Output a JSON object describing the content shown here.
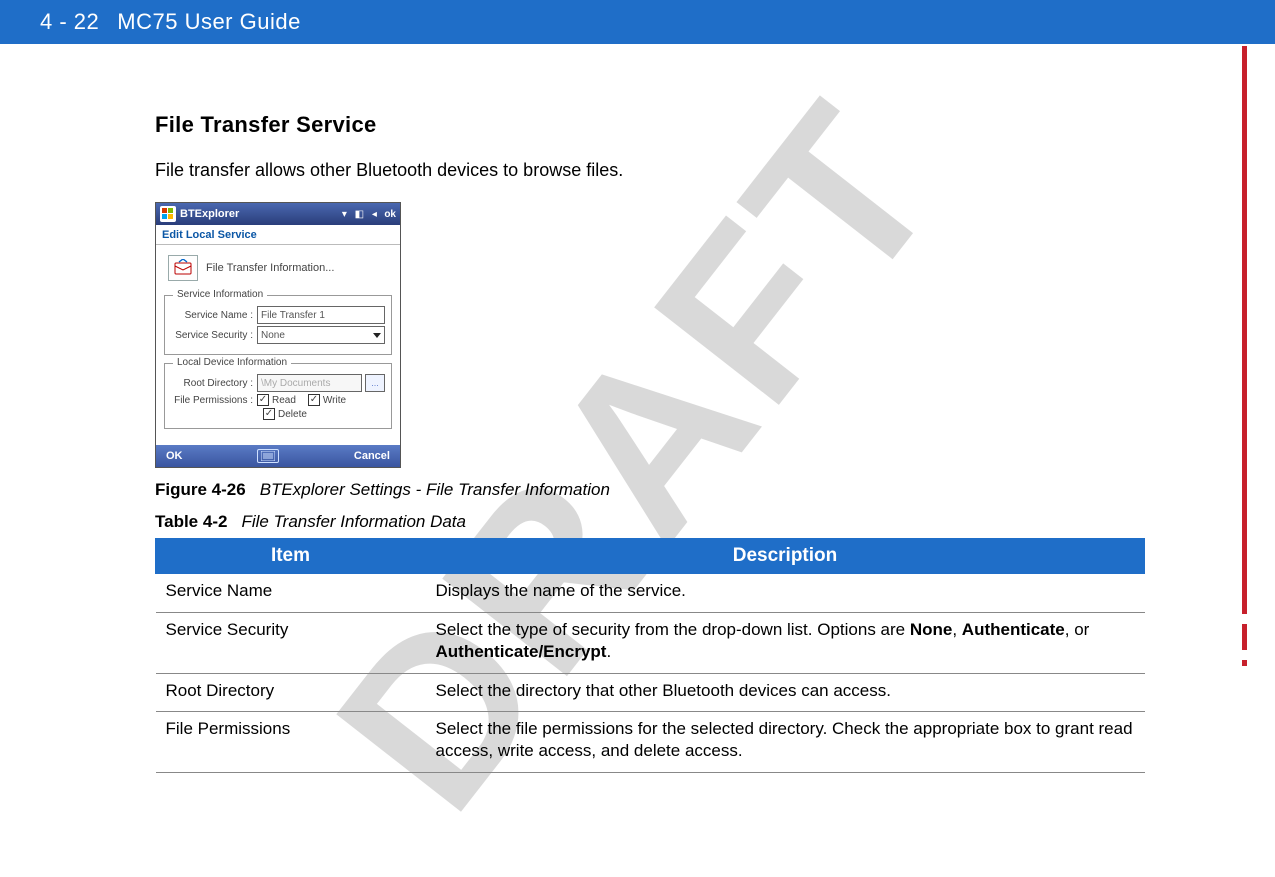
{
  "header": {
    "page_number": "4 - 22",
    "doc_title": "MC75 User Guide"
  },
  "watermark": "DRAFT",
  "section": {
    "heading": "File Transfer Service",
    "intro": "File transfer allows other Bluetooth devices to browse files."
  },
  "screenshot": {
    "window_title": "BTExplorer",
    "ok_label": "ok",
    "subheader": "Edit Local Service",
    "info_label": "File Transfer Information...",
    "group1_legend": "Service Information",
    "service_name_label": "Service Name :",
    "service_name_value": "File Transfer 1",
    "service_security_label": "Service Security :",
    "service_security_value": "None",
    "group2_legend": "Local Device Information",
    "root_dir_label": "Root Directory :",
    "root_dir_value": "\\My Documents",
    "file_perm_label": "File Permissions :",
    "perm_read": "Read",
    "perm_write": "Write",
    "perm_delete": "Delete",
    "btn_ok": "OK",
    "btn_cancel": "Cancel"
  },
  "figure": {
    "lead": "Figure 4-26",
    "caption": "BTExplorer Settings - File Transfer Information"
  },
  "table_caption": {
    "lead": "Table 4-2",
    "caption": "File Transfer Information Data"
  },
  "table": {
    "headers": {
      "item": "Item",
      "desc": "Description"
    },
    "rows": [
      {
        "item": "Service Name",
        "desc_html": "Displays the name of the service."
      },
      {
        "item": "Service Security",
        "desc_html": "Select the type of security from the drop-down list. Options are <b>None</b>, <b>Authenticate</b>, or <b>Authenticate/Encrypt</b>."
      },
      {
        "item": "Root Directory",
        "desc_html": "Select the directory that other Bluetooth devices can access."
      },
      {
        "item": "File Permissions",
        "desc_html": "Select the file permissions for the selected directory. Check the appropriate box to grant read access, write access, and delete access."
      }
    ]
  }
}
